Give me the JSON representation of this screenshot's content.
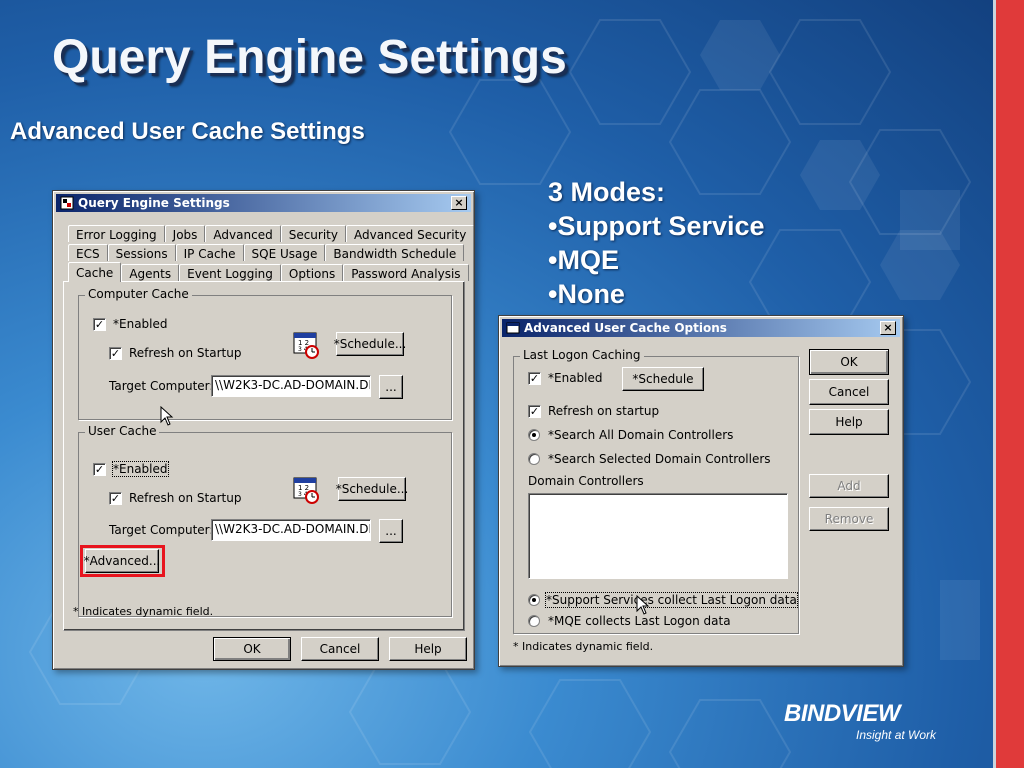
{
  "slide": {
    "title": "Query Engine Settings",
    "subtitle": "Advanced User Cache Settings",
    "modes_heading": "3 Modes:",
    "modes": [
      "•Support Service",
      "•MQE",
      "•None"
    ],
    "logo_text": "BINDVIEW",
    "logo_tagline": "Insight at Work",
    "accent_color": "#e03a3a"
  },
  "dialog1": {
    "title": "Query Engine Settings",
    "close_glyph": "×",
    "tabs_row1": [
      "Error Logging",
      "Jobs",
      "Advanced",
      "Security",
      "Advanced Security"
    ],
    "tabs_row2": [
      "ECS",
      "Sessions",
      "IP Cache",
      "SQE Usage",
      "Bandwidth Schedule"
    ],
    "tabs_row3": [
      "Cache",
      "Agents",
      "Event Logging",
      "Options",
      "Password Analysis"
    ],
    "computer_cache": {
      "label": "Computer Cache",
      "enabled_label": "*Enabled",
      "enabled_checked": true,
      "refresh_label": "Refresh on Startup",
      "refresh_checked": true,
      "schedule_label": "*Schedule...",
      "target_label": "Target Computer:",
      "target_value": "\\\\W2K3-DC.AD-DOMAIN.DE",
      "browse_label": "..."
    },
    "user_cache": {
      "label": "User Cache",
      "enabled_label": "*Enabled",
      "enabled_checked": true,
      "refresh_label": "Refresh on Startup",
      "refresh_checked": true,
      "schedule_label": "*Schedule...",
      "target_label": "Target Computer:",
      "target_value": "\\\\W2K3-DC.AD-DOMAIN.DE",
      "browse_label": "...",
      "advanced_label": "*Advanced..."
    },
    "footnote": "* Indicates dynamic field.",
    "ok_label": "OK",
    "cancel_label": "Cancel",
    "help_label": "Help"
  },
  "dialog2": {
    "title": "Advanced User Cache Options",
    "close_glyph": "×",
    "group_label": "Last Logon Caching",
    "enabled_label": "*Enabled",
    "enabled_checked": true,
    "schedule_label": "*Schedule",
    "refresh_label": "Refresh on startup",
    "refresh_checked": true,
    "search_all_label": "*Search All Domain Controllers",
    "search_selected_label": "*Search Selected Domain Controllers",
    "domain_controllers_label": "Domain Controllers",
    "support_services_label": "*Support Services collect Last Logon data",
    "mqe_label": "*MQE collects Last Logon data",
    "footnote": "* Indicates dynamic field.",
    "ok_label": "OK",
    "cancel_label": "Cancel",
    "help_label": "Help",
    "add_label": "Add",
    "remove_label": "Remove"
  }
}
